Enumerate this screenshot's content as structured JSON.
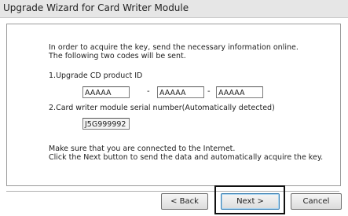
{
  "window": {
    "title": "Upgrade Wizard for Card Writer Module"
  },
  "content": {
    "intro_line1": "In order to acquire the key, send the necessary information online.",
    "intro_line2": "The following two codes will be sent.",
    "product_id_label": "1.Upgrade CD product ID",
    "product_id_fields": [
      "AAAAA",
      "AAAAA",
      "AAAAA"
    ],
    "separator": "-",
    "serial_label": "2.Card writer module serial number(Automatically detected)",
    "serial_value": "J5G999992",
    "footer_line1": "Make sure that you are connected to the Internet.",
    "footer_line2": "Click the Next button to send the data and automatically acquire the key."
  },
  "buttons": {
    "back": "< Back",
    "next": "Next >",
    "cancel": "Cancel"
  }
}
